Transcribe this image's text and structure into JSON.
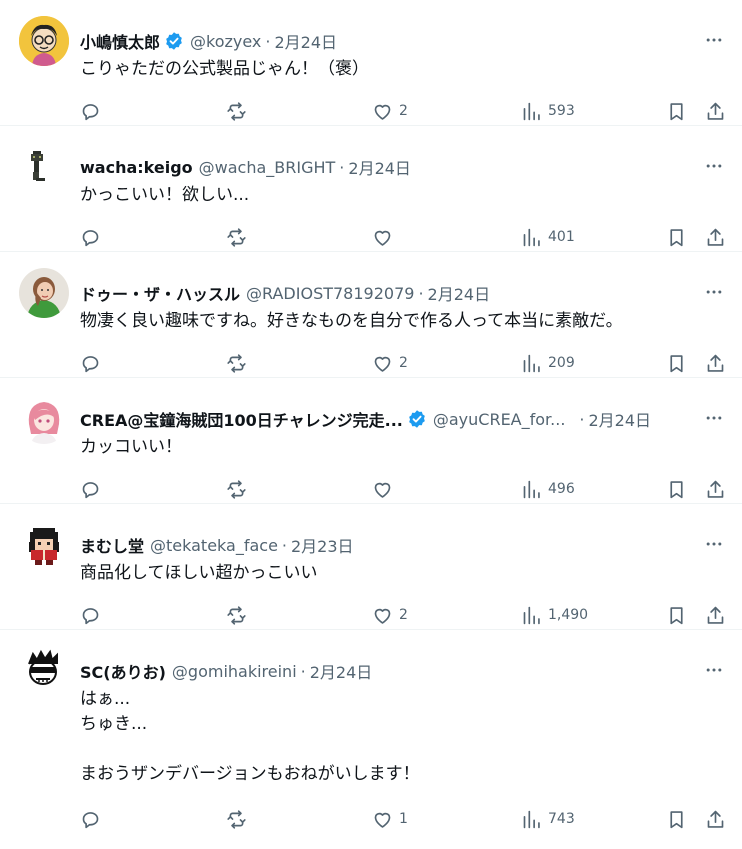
{
  "posts": [
    {
      "name": "小嶋慎太郎",
      "verified": true,
      "handle": "@kozyex",
      "separator": "·",
      "date": "2月24日",
      "text": "こりゃただの公式製品じゃん！（褒）",
      "replies": "",
      "reposts": "",
      "likes": "2",
      "views": "593"
    },
    {
      "name": "wacha:keigo",
      "verified": false,
      "handle": "@wacha_BRIGHT",
      "separator": "·",
      "date": "2月24日",
      "text": "かっこいい！欲しい...",
      "replies": "",
      "reposts": "",
      "likes": "",
      "views": "401"
    },
    {
      "name": "ドゥー・ザ・ハッスル",
      "verified": false,
      "handle": "@RADIOST78192079",
      "separator": "·",
      "date": "2月24日",
      "text": "物凄く良い趣味ですね。好きなものを自分で作る人って本当に素敵だ。",
      "replies": "",
      "reposts": "",
      "likes": "2",
      "views": "209"
    },
    {
      "name": "CREA@宝鐘海賊団100日チャレンジ完走...",
      "verified": true,
      "handle": "@ayuCREA_for...",
      "separator": "·",
      "date": "2月24日",
      "text": "カッコいい！",
      "replies": "",
      "reposts": "",
      "likes": "",
      "views": "496"
    },
    {
      "name": "まむし堂",
      "verified": false,
      "handle": "@tekateka_face",
      "separator": "·",
      "date": "2月23日",
      "text": "商品化してほしい超かっこいい",
      "replies": "",
      "reposts": "",
      "likes": "2",
      "views": "1,490"
    },
    {
      "name": "SC(ありお)",
      "verified": false,
      "handle": "@gomihakireini",
      "separator": "·",
      "date": "2月24日",
      "text": "はぁ...\nちゅき...\n\nまおうザンデバージョンもおねがいします！",
      "replies": "",
      "reposts": "",
      "likes": "1",
      "views": "743"
    }
  ],
  "icons": {
    "more": "more-horizontal-icon",
    "reply": "reply-icon",
    "repost": "repost-icon",
    "like": "heart-icon",
    "views": "views-bar-chart-icon",
    "bookmark": "bookmark-icon",
    "share": "share-icon",
    "verified": "verified-badge-icon"
  },
  "colors": {
    "text": "#0f1419",
    "secondary": "#536471",
    "verified": "#1d9bf0",
    "divider": "#eff3f4"
  }
}
